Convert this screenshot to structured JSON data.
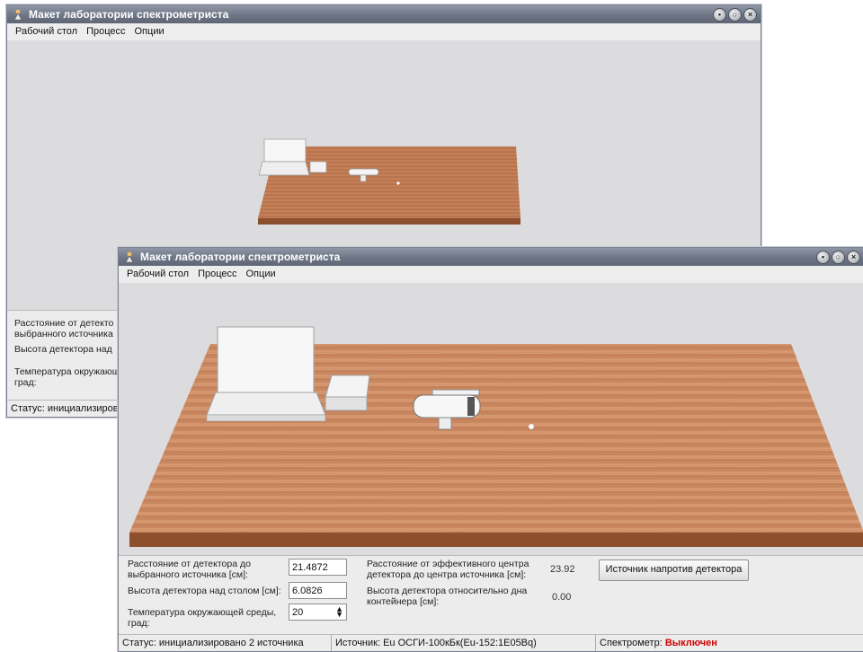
{
  "window": {
    "title": "Макет лаборатории спектрометриста",
    "menu": [
      "Рабочий стол",
      "Процесс",
      "Опции"
    ]
  },
  "controls": {
    "distance_label": "Расстояние от детектора до выбранного источника [см]:",
    "distance_value": "21.4872",
    "height_label": "Высота детектора над столом [см]:",
    "height_value": "6.0826",
    "temp_label": "Температура окружающей среды, град:",
    "temp_value": "20",
    "eff_center_label": "Расстояние от эффективного центра детектора до центра источника [см]:",
    "eff_center_value": "23.92",
    "height_container_label": "Высота детектора относительно дна контейнера [см]:",
    "height_container_value": "0.00",
    "source_button": "Источник напротив детектора"
  },
  "back_panel": {
    "distance_label_cut": "Расстояние от детекто выбранного источника",
    "height_label_cut": "Высота детектора над",
    "temp_label_cut": "Температура окружающ град:",
    "status_cut": "Статус: инициализиров"
  },
  "status": {
    "status_text": "Статус: инициализировано 2 источника",
    "source_text": "Источник: Eu ОСГИ-100кБк(Eu-152:1E05Bq)",
    "spectrometer_label": "Спектрометр:",
    "spectrometer_state": "Выключен",
    "state_color": "#d40000"
  }
}
